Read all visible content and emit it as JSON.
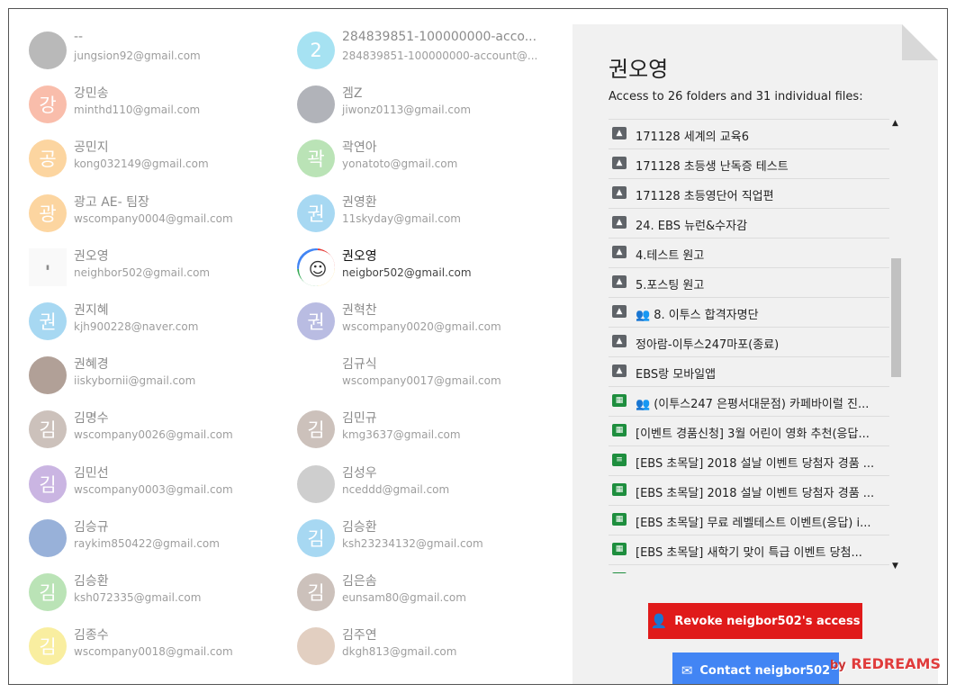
{
  "people": [
    {
      "name": "--",
      "email": "jungsion92@gmail.com",
      "initial": "",
      "color": "#7a7a7a",
      "type": "img"
    },
    {
      "name": "284839851-100000000-acco...",
      "email": "284839851-100000000-account@...",
      "initial": "2",
      "color": "#56c8e8",
      "type": "initial"
    },
    {
      "name": "강민송",
      "email": "minthd110@gmail.com",
      "initial": "강",
      "color": "#f4825f",
      "type": "initial"
    },
    {
      "name": "겜Z",
      "email": "jiwonz0113@gmail.com",
      "initial": "",
      "color": "#6a6f7a",
      "type": "img"
    },
    {
      "name": "공민지",
      "email": "kong032149@gmail.com",
      "initial": "공",
      "color": "#fbb04a",
      "type": "initial"
    },
    {
      "name": "곽연아",
      "email": "yonatoto@gmail.com",
      "initial": "곽",
      "color": "#7ccb75",
      "type": "initial"
    },
    {
      "name": "광고 AE- 팀장",
      "email": "wscompany0004@gmail.com",
      "initial": "광",
      "color": "#fbb04a",
      "type": "initial"
    },
    {
      "name": "권영환",
      "email": "11skyday@gmail.com",
      "initial": "권",
      "color": "#57b5e8",
      "type": "initial"
    },
    {
      "name": "권오영",
      "email": "neighbor502@gmail.com",
      "initial": "",
      "color": "#f4f4f4",
      "type": "logo"
    },
    {
      "name": "권오영",
      "email": "neigbor502@gmail.com",
      "initial": "",
      "color": "#ffffff",
      "type": "selected"
    },
    {
      "name": "권지혜",
      "email": "kjh900228@naver.com",
      "initial": "권",
      "color": "#57b5e8",
      "type": "initial"
    },
    {
      "name": "권혁찬",
      "email": "wscompany0020@gmail.com",
      "initial": "권",
      "color": "#7a7fc9",
      "type": "initial"
    },
    {
      "name": "권혜경",
      "email": "iiskybornii@gmail.com",
      "initial": "",
      "color": "#6b4a3a",
      "type": "img"
    },
    {
      "name": "김규식",
      "email": "wscompany0017@gmail.com",
      "initial": "",
      "color": "transparent",
      "type": "none"
    },
    {
      "name": "김명수",
      "email": "wscompany0026@gmail.com",
      "initial": "김",
      "color": "#9e8a7e",
      "type": "initial"
    },
    {
      "name": "김민규",
      "email": "kmg3637@gmail.com",
      "initial": "김",
      "color": "#9e8a7e",
      "type": "initial"
    },
    {
      "name": "김민선",
      "email": "wscompany0003@gmail.com",
      "initial": "김",
      "color": "#9a73c9",
      "type": "initial"
    },
    {
      "name": "김성우",
      "email": "nceddd@gmail.com",
      "initial": "",
      "color": "#a3a3a3",
      "type": "img"
    },
    {
      "name": "김승규",
      "email": "raykim850422@gmail.com",
      "initial": "",
      "color": "#3b6ab8",
      "type": "img"
    },
    {
      "name": "김승환",
      "email": "ksh23234132@gmail.com",
      "initial": "김",
      "color": "#57b5e8",
      "type": "initial"
    },
    {
      "name": "김승환",
      "email": "ksh072335@gmail.com",
      "initial": "김",
      "color": "#7ccb75",
      "type": "initial"
    },
    {
      "name": "김은솜",
      "email": "eunsam80@gmail.com",
      "initial": "김",
      "color": "#9e8a7e",
      "type": "initial"
    },
    {
      "name": "김종수",
      "email": "wscompany0018@gmail.com",
      "initial": "김",
      "color": "#f4e04a",
      "type": "initial"
    },
    {
      "name": "김주연",
      "email": "dkgh813@gmail.com",
      "initial": "",
      "color": "#c9a48a",
      "type": "img"
    }
  ],
  "panel": {
    "title": "권오영",
    "subtitle": "Access to 26 folders and 31 individual files:",
    "files": [
      {
        "icon": "folder",
        "shared": false,
        "label": "171128 세계의 교육6"
      },
      {
        "icon": "folder",
        "shared": false,
        "label": "171128 초등생 난독증 테스트"
      },
      {
        "icon": "folder",
        "shared": false,
        "label": "171128 초등영단어 직업편"
      },
      {
        "icon": "folder",
        "shared": false,
        "label": "24. EBS 뉴런&수자감"
      },
      {
        "icon": "folder",
        "shared": false,
        "label": "4.테스트 원고"
      },
      {
        "icon": "folder",
        "shared": false,
        "label": "5.포스팅 원고"
      },
      {
        "icon": "folder",
        "shared": true,
        "label": "8. 이투스 합격자명단"
      },
      {
        "icon": "folder",
        "shared": false,
        "label": "정아람-이투스247마포(종료)"
      },
      {
        "icon": "folder",
        "shared": false,
        "label": "EBS랑 모바일앱"
      },
      {
        "icon": "sheet",
        "shared": true,
        "label": "(이투스247 은평서대문점) 카페바이럴 진..."
      },
      {
        "icon": "sheet",
        "shared": false,
        "label": "[이벤트 경품신청] 3월 어린이 영화 추천(응답..."
      },
      {
        "icon": "form",
        "shared": false,
        "label": "[EBS 초목달] 2018 설날 이벤트 당첨자 경품 ..."
      },
      {
        "icon": "sheet",
        "shared": false,
        "label": "[EBS 초목달] 2018 설날 이벤트 당첨자 경품 ..."
      },
      {
        "icon": "sheet",
        "shared": false,
        "label": "[EBS 초목달] 무료 레벨테스트 이벤트(응답) i..."
      },
      {
        "icon": "sheet",
        "shared": false,
        "label": "[EBS 초목달] 새학기 맞이 특급 이벤트 당첨..."
      },
      {
        "icon": "sheet",
        "shared": false,
        "label": ""
      }
    ],
    "revoke_label": "Revoke neigbor502's access",
    "contact_label": "Contact neigbor502"
  },
  "watermark": {
    "by": "by",
    "brand": "REDREAMS"
  }
}
